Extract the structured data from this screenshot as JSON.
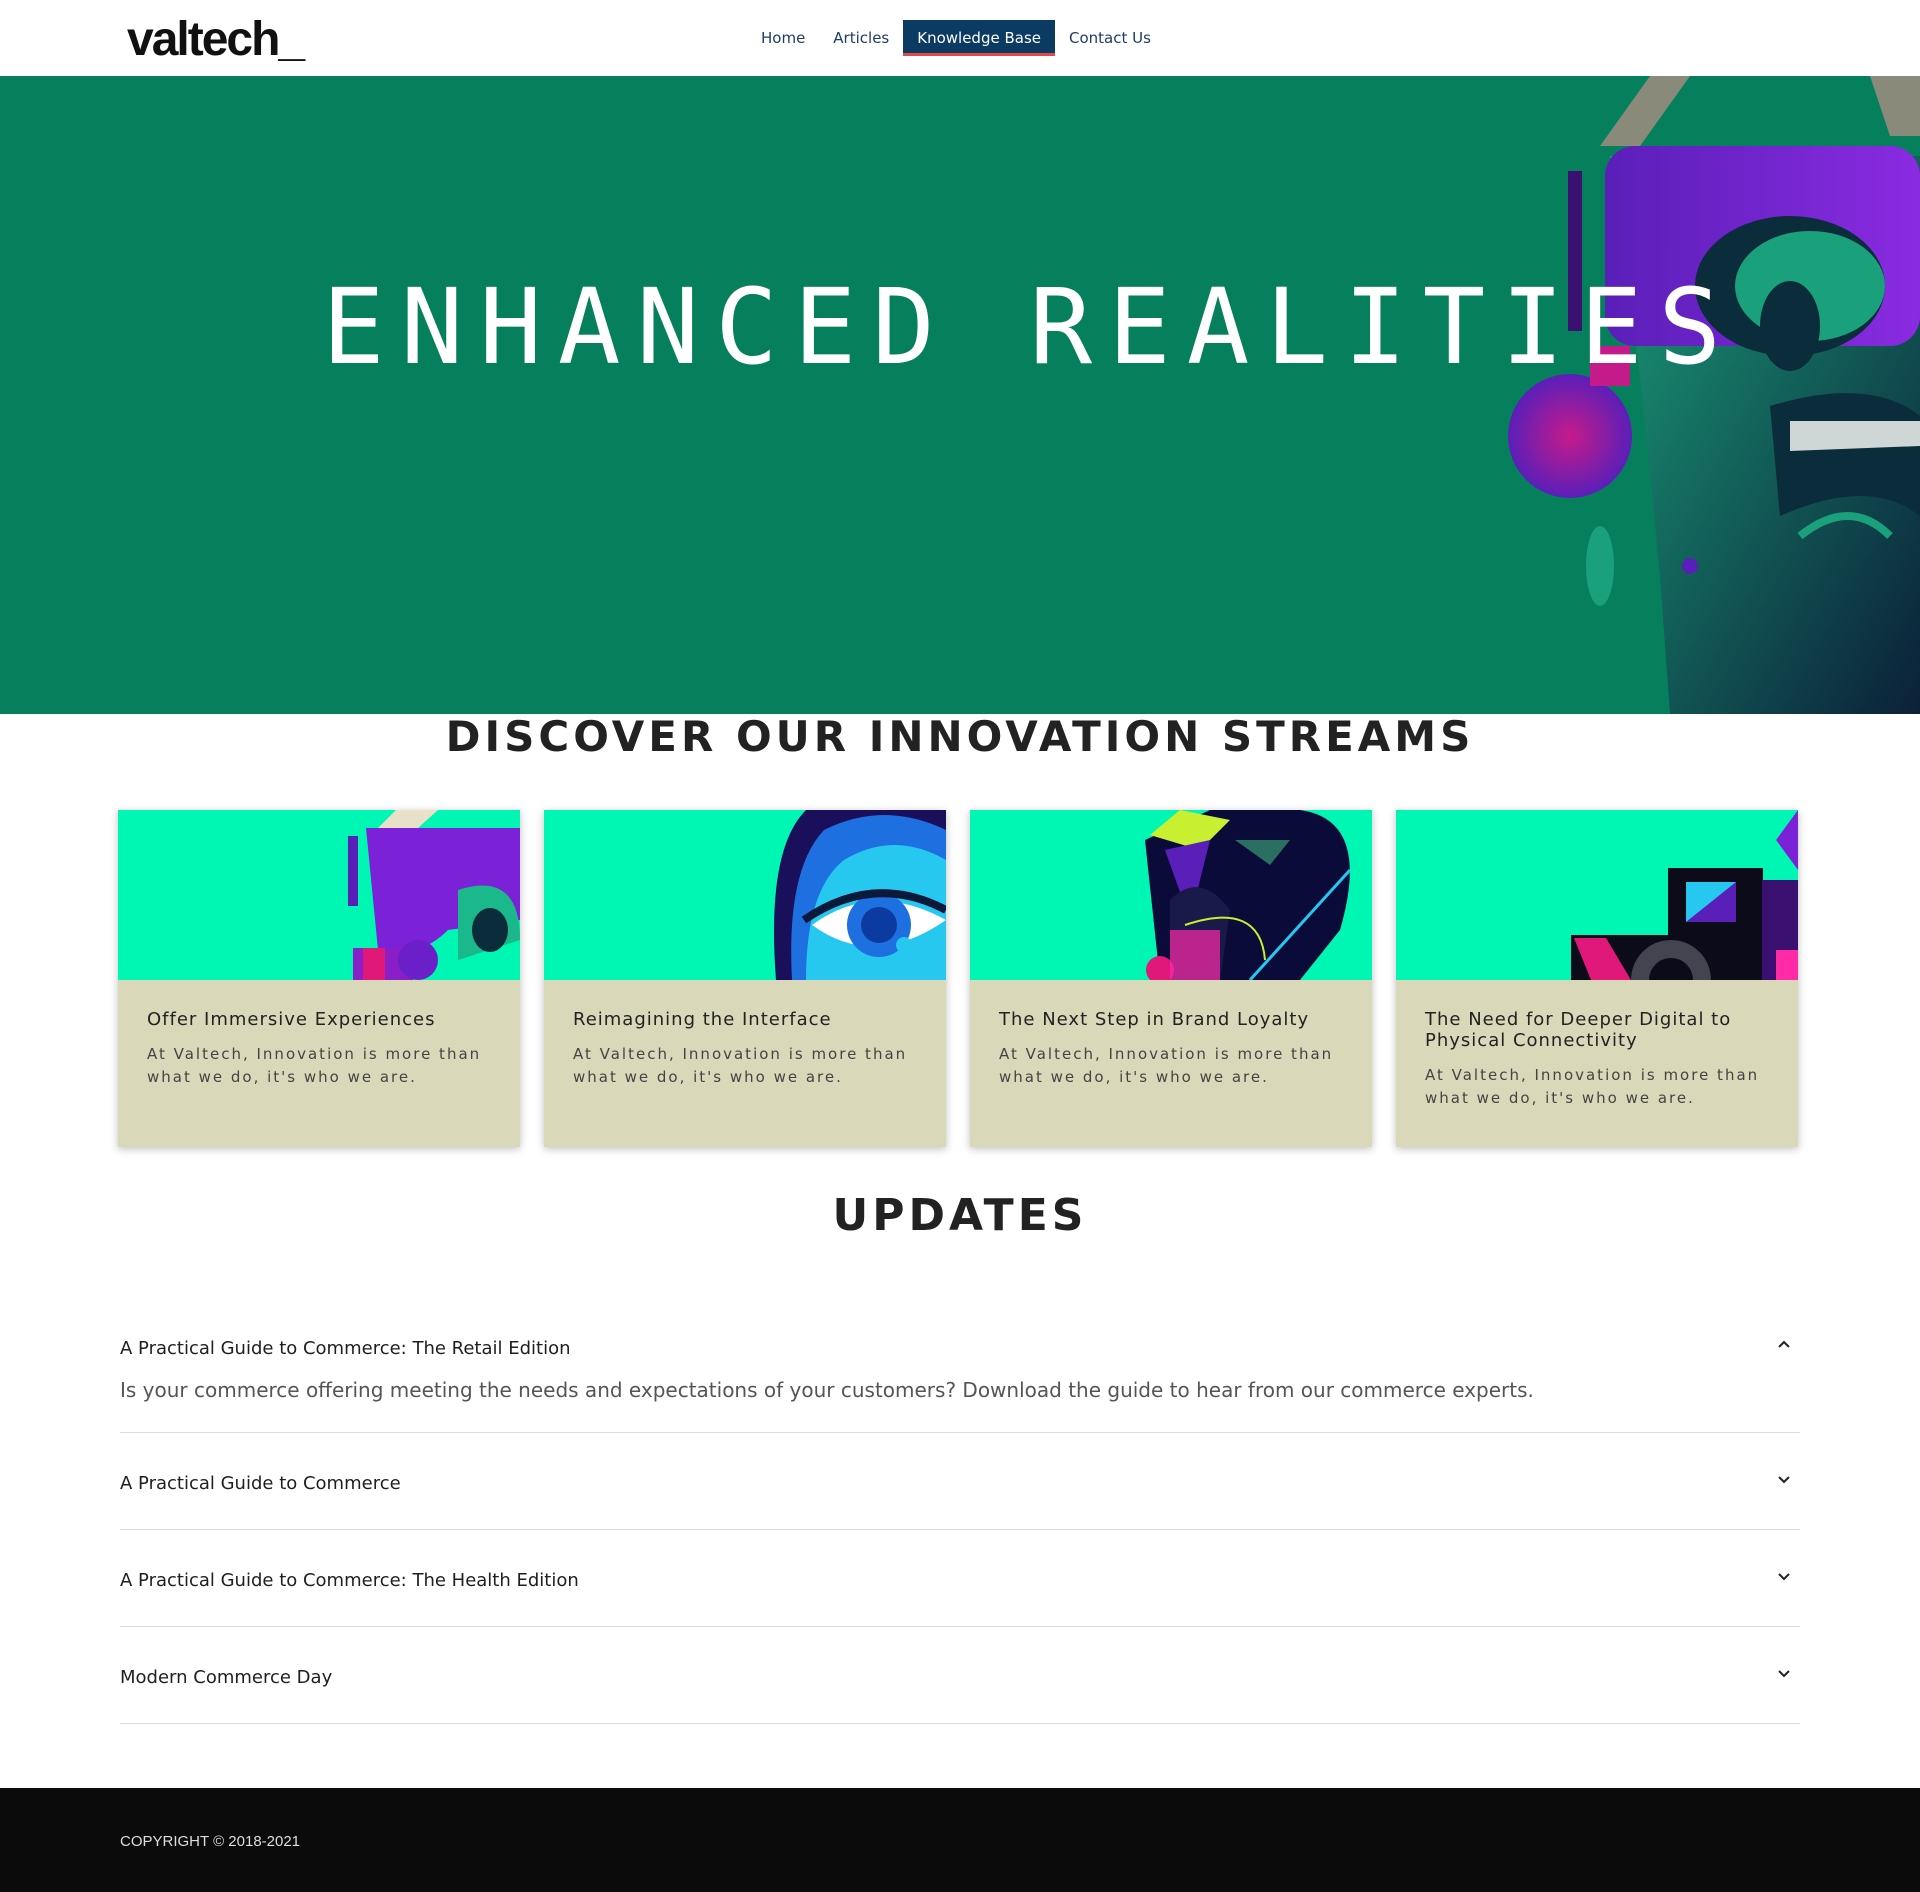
{
  "header": {
    "logo": "valtech_",
    "nav": [
      {
        "label": "Home",
        "active": false
      },
      {
        "label": "Articles",
        "active": false
      },
      {
        "label": "Knowledge Base",
        "active": true
      },
      {
        "label": "Contact Us",
        "active": false
      }
    ]
  },
  "hero": {
    "title": "ENHANCED REALITIES",
    "background": "#06805c"
  },
  "discover": {
    "title": "DISCOVER OUR INNOVATION STREAMS",
    "cards": [
      {
        "title": "Offer Immersive Experiences",
        "text": "At Valtech, Innovation is more than what we do, it's who we are."
      },
      {
        "title": "Reimagining the Interface",
        "text": "At Valtech, Innovation is more than what we do, it's who we are."
      },
      {
        "title": "The Next Step in Brand Loyalty",
        "text": "At Valtech, Innovation is more than what we do, it's who we are."
      },
      {
        "title": "The Need for Deeper Digital to Physical Connectivity",
        "text": "At Valtech, Innovation is more than what we do, it's who we are."
      }
    ]
  },
  "updates": {
    "title": "UPDATES",
    "items": [
      {
        "title": "A Practical Guide to Commerce: The Retail Edition",
        "expanded": true,
        "body": "Is your commerce offering meeting the needs and expectations of your customers? Download the guide to hear from our commerce experts."
      },
      {
        "title": "A Practical Guide to Commerce",
        "expanded": false
      },
      {
        "title": "A Practical Guide to Commerce: The Health Edition",
        "expanded": false
      },
      {
        "title": "Modern Commerce Day",
        "expanded": false
      }
    ]
  },
  "footer": {
    "copyright": "COPYRIGHT © 2018-2021"
  },
  "colors": {
    "accent": "#0b3a63",
    "active_underline": "#e0484a",
    "card_image_bg": "#00f6b3",
    "card_bg": "#d9d8b9",
    "footer_bg": "#0b0b0b"
  }
}
